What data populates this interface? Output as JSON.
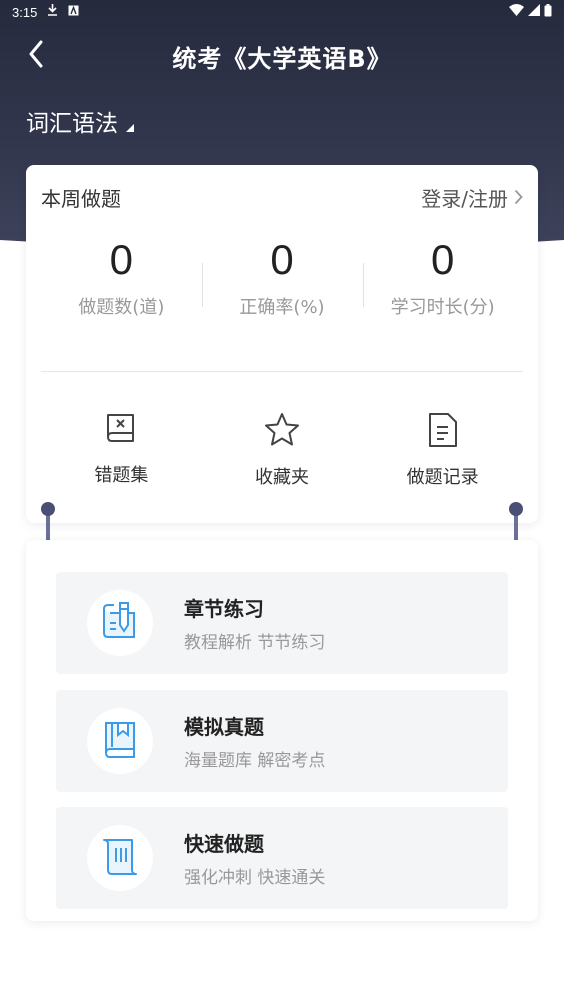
{
  "status_bar": {
    "time": "3:15"
  },
  "nav": {
    "title": "统考《大学英语B》"
  },
  "subject": {
    "label": "词汇语法"
  },
  "stats_card": {
    "week_label": "本周做题",
    "login_label": "登录/注册",
    "stats": [
      {
        "value": "0",
        "label": "做题数(道)"
      },
      {
        "value": "0",
        "label": "正确率(%)"
      },
      {
        "value": "0",
        "label": "学习时长(分)"
      }
    ],
    "tools": [
      {
        "label": "错题集",
        "icon": "wrong-book-icon"
      },
      {
        "label": "收藏夹",
        "icon": "star-icon"
      },
      {
        "label": "做题记录",
        "icon": "document-icon"
      }
    ]
  },
  "practice": {
    "items": [
      {
        "title": "章节练习",
        "desc": "教程解析 节节练习",
        "icon": "pen-book-icon"
      },
      {
        "title": "模拟真题",
        "desc": "海量题库 解密考点",
        "icon": "bookmark-book-icon"
      },
      {
        "title": "快速做题",
        "desc": "强化冲刺 快速通关",
        "icon": "scroll-icon"
      }
    ]
  },
  "colors": {
    "header": "#2f3347",
    "accent_icon": "#3b9be8",
    "card_bg": "#ffffff",
    "item_bg": "#f4f5f7"
  }
}
